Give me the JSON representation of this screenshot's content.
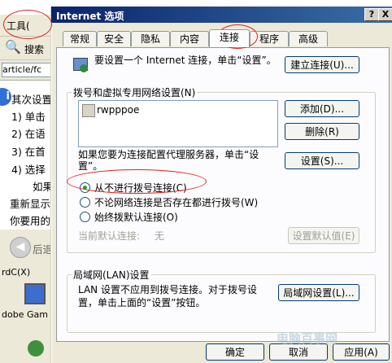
{
  "background": {
    "menu_tools": "工具(",
    "toolbar_search": "搜索",
    "address": "article/fc",
    "lines": [
      "其次设置",
      "1) 单击",
      "2) 在语",
      "3) 在首",
      "4) 选择",
      "如果",
      "重新显示",
      "你要用的"
    ],
    "back_label": "后退",
    "status": "rdC(X)",
    "desktop_item": "dobe Gam"
  },
  "dialog": {
    "title": "Internet 选项",
    "help_btn": "?",
    "close_btn": "X",
    "tabs": [
      "常规",
      "安全",
      "隐私",
      "内容",
      "连接",
      "程序",
      "高级"
    ],
    "active_tab": "连接",
    "setup_text": "要设置一个 Internet 连接，单击“设置”。",
    "setup_button": "建立连接(U)...",
    "dialup_group": "拨号和虚拟专用网络设置(N)",
    "dialup_entry": "rwpppoe",
    "add_button": "添加(D)...",
    "delete_button": "删除(R)",
    "proxy_text": "如果您要为连接配置代理服务器，单击“设置”。",
    "settings_button": "设置(S)...",
    "radios": [
      {
        "label": "从不进行拨号连接(C)",
        "checked": true
      },
      {
        "label": "不论网络连接是否存在都进行拨号(W)",
        "checked": false
      },
      {
        "label": "始终拨默认连接(O)",
        "checked": false
      }
    ],
    "default_label": "当前默认连接:",
    "default_value": "无",
    "set_default_button": "设置默认值(E)",
    "lan_group": "局域网(LAN)设置",
    "lan_text_1": "LAN 设置不应用到拨号连接。对于拨号设",
    "lan_text_2": "置，单击上面的“设置”按钮。",
    "lan_button": "局域网设置(L)...",
    "ok_button": "确定",
    "cancel_button": "取消",
    "apply_button": "应用(A)"
  },
  "watermark": "电脑百事网",
  "colors": {
    "annotation": "#e02020",
    "titlebar": "#0a246a"
  }
}
